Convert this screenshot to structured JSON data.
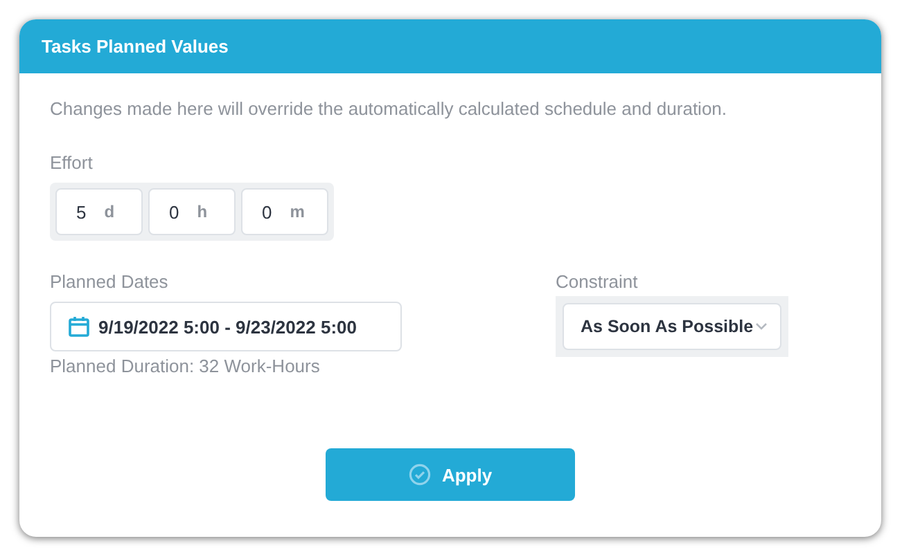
{
  "dialog": {
    "title": "Tasks Planned Values"
  },
  "notice": "Changes made here will override the automatically calculated schedule and duration.",
  "effort": {
    "label": "Effort",
    "fields": [
      {
        "value": "5",
        "unit": "d"
      },
      {
        "value": "0",
        "unit": "h"
      },
      {
        "value": "0",
        "unit": "m"
      }
    ]
  },
  "planned_dates": {
    "label": "Planned Dates",
    "value": "9/19/2022 5:00 - 9/23/2022 5:00",
    "duration": "Planned Duration: 32 Work-Hours"
  },
  "constraint": {
    "label": "Constraint",
    "value": "As Soon As Possible"
  },
  "buttons": [
    {
      "label": "Apply"
    }
  ]
}
